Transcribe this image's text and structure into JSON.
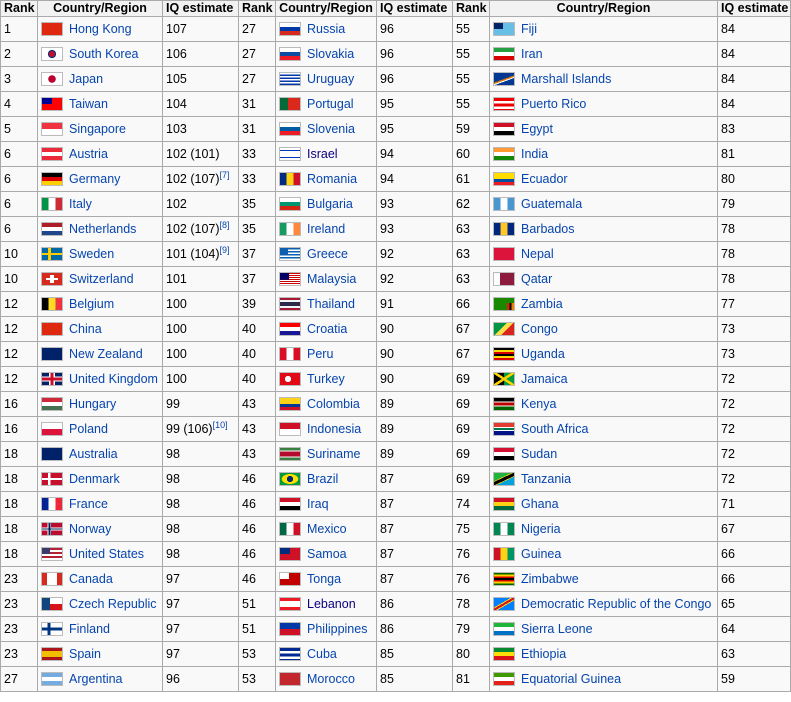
{
  "headers": [
    "Rank",
    "Country/Region",
    "IQ estimate",
    "Rank",
    "Country/Region",
    "IQ estimate",
    "Rank",
    "Country/Region",
    "IQ estimate"
  ],
  "rows": [
    [
      {
        "rank": "1",
        "country": "Hong Kong",
        "iq": "107",
        "flag": "hong-kong"
      },
      {
        "rank": "27",
        "country": "Russia",
        "iq": "96",
        "flag": "russia"
      },
      {
        "rank": "55",
        "country": "Fiji",
        "iq": "84",
        "flag": "fiji"
      }
    ],
    [
      {
        "rank": "2",
        "country": "South Korea",
        "iq": "106",
        "flag": "south-korea"
      },
      {
        "rank": "27",
        "country": "Slovakia",
        "iq": "96",
        "flag": "slovakia"
      },
      {
        "rank": "55",
        "country": "Iran",
        "iq": "84",
        "flag": "iran"
      }
    ],
    [
      {
        "rank": "3",
        "country": "Japan",
        "iq": "105",
        "flag": "japan"
      },
      {
        "rank": "27",
        "country": "Uruguay",
        "iq": "96",
        "flag": "uruguay"
      },
      {
        "rank": "55",
        "country": "Marshall Islands",
        "iq": "84",
        "flag": "marshall-islands"
      }
    ],
    [
      {
        "rank": "4",
        "country": "Taiwan",
        "iq": "104",
        "flag": "taiwan"
      },
      {
        "rank": "31",
        "country": "Portugal",
        "iq": "95",
        "flag": "portugal"
      },
      {
        "rank": "55",
        "country": "Puerto Rico",
        "iq": "84",
        "flag": "puerto-rico"
      }
    ],
    [
      {
        "rank": "5",
        "country": "Singapore",
        "iq": "103",
        "flag": "singapore"
      },
      {
        "rank": "31",
        "country": "Slovenia",
        "iq": "95",
        "flag": "slovenia"
      },
      {
        "rank": "59",
        "country": "Egypt",
        "iq": "83",
        "flag": "egypt"
      }
    ],
    [
      {
        "rank": "6",
        "country": "Austria",
        "iq": "102 (101)",
        "flag": "austria"
      },
      {
        "rank": "33",
        "country": "Israel",
        "iq": "94",
        "flag": "israel",
        "visited": true
      },
      {
        "rank": "60",
        "country": "India",
        "iq": "81",
        "flag": "india"
      }
    ],
    [
      {
        "rank": "6",
        "country": "Germany",
        "iq": "102 (107)",
        "ref": "[7]",
        "flag": "germany"
      },
      {
        "rank": "33",
        "country": "Romania",
        "iq": "94",
        "flag": "romania"
      },
      {
        "rank": "61",
        "country": "Ecuador",
        "iq": "80",
        "flag": "ecuador"
      }
    ],
    [
      {
        "rank": "6",
        "country": "Italy",
        "iq": "102",
        "flag": "italy"
      },
      {
        "rank": "35",
        "country": "Bulgaria",
        "iq": "93",
        "flag": "bulgaria"
      },
      {
        "rank": "62",
        "country": "Guatemala",
        "iq": "79",
        "flag": "guatemala"
      }
    ],
    [
      {
        "rank": "6",
        "country": "Netherlands",
        "iq": "102 (107)",
        "ref": "[8]",
        "flag": "netherlands"
      },
      {
        "rank": "35",
        "country": "Ireland",
        "iq": "93",
        "flag": "ireland"
      },
      {
        "rank": "63",
        "country": "Barbados",
        "iq": "78",
        "flag": "barbados"
      }
    ],
    [
      {
        "rank": "10",
        "country": "Sweden",
        "iq": "101 (104)",
        "ref": "[9]",
        "flag": "sweden"
      },
      {
        "rank": "37",
        "country": "Greece",
        "iq": "92",
        "flag": "greece"
      },
      {
        "rank": "63",
        "country": "Nepal",
        "iq": "78",
        "flag": "nepal"
      }
    ],
    [
      {
        "rank": "10",
        "country": "Switzerland",
        "iq": "101",
        "flag": "switzerland"
      },
      {
        "rank": "37",
        "country": "Malaysia",
        "iq": "92",
        "flag": "malaysia"
      },
      {
        "rank": "63",
        "country": "Qatar",
        "iq": "78",
        "flag": "qatar"
      }
    ],
    [
      {
        "rank": "12",
        "country": "Belgium",
        "iq": "100",
        "flag": "belgium"
      },
      {
        "rank": "39",
        "country": "Thailand",
        "iq": "91",
        "flag": "thailand"
      },
      {
        "rank": "66",
        "country": "Zambia",
        "iq": "77",
        "flag": "zambia"
      }
    ],
    [
      {
        "rank": "12",
        "country": "China",
        "iq": "100",
        "flag": "china"
      },
      {
        "rank": "40",
        "country": "Croatia",
        "iq": "90",
        "flag": "croatia"
      },
      {
        "rank": "67",
        "country": "Congo",
        "iq": "73",
        "flag": "congo"
      }
    ],
    [
      {
        "rank": "12",
        "country": "New Zealand",
        "iq": "100",
        "flag": "new-zealand"
      },
      {
        "rank": "40",
        "country": "Peru",
        "iq": "90",
        "flag": "peru"
      },
      {
        "rank": "67",
        "country": "Uganda",
        "iq": "73",
        "flag": "uganda"
      }
    ],
    [
      {
        "rank": "12",
        "country": "United Kingdom",
        "iq": "100",
        "flag": "united-kingdom"
      },
      {
        "rank": "40",
        "country": "Turkey",
        "iq": "90",
        "flag": "turkey"
      },
      {
        "rank": "69",
        "country": "Jamaica",
        "iq": "72",
        "flag": "jamaica"
      }
    ],
    [
      {
        "rank": "16",
        "country": "Hungary",
        "iq": "99",
        "flag": "hungary"
      },
      {
        "rank": "43",
        "country": "Colombia",
        "iq": "89",
        "flag": "colombia"
      },
      {
        "rank": "69",
        "country": "Kenya",
        "iq": "72",
        "flag": "kenya"
      }
    ],
    [
      {
        "rank": "16",
        "country": "Poland",
        "iq": "99 (106)",
        "ref": "[10]",
        "flag": "poland"
      },
      {
        "rank": "43",
        "country": "Indonesia",
        "iq": "89",
        "flag": "indonesia"
      },
      {
        "rank": "69",
        "country": "South Africa",
        "iq": "72",
        "flag": "south-africa"
      }
    ],
    [
      {
        "rank": "18",
        "country": "Australia",
        "iq": "98",
        "flag": "australia"
      },
      {
        "rank": "43",
        "country": "Suriname",
        "iq": "89",
        "flag": "suriname"
      },
      {
        "rank": "69",
        "country": "Sudan",
        "iq": "72",
        "flag": "sudan"
      }
    ],
    [
      {
        "rank": "18",
        "country": "Denmark",
        "iq": "98",
        "flag": "denmark"
      },
      {
        "rank": "46",
        "country": "Brazil",
        "iq": "87",
        "flag": "brazil"
      },
      {
        "rank": "69",
        "country": "Tanzania",
        "iq": "72",
        "flag": "tanzania"
      }
    ],
    [
      {
        "rank": "18",
        "country": "France",
        "iq": "98",
        "flag": "france"
      },
      {
        "rank": "46",
        "country": "Iraq",
        "iq": "87",
        "flag": "iraq"
      },
      {
        "rank": "74",
        "country": "Ghana",
        "iq": "71",
        "flag": "ghana"
      }
    ],
    [
      {
        "rank": "18",
        "country": "Norway",
        "iq": "98",
        "flag": "norway"
      },
      {
        "rank": "46",
        "country": "Mexico",
        "iq": "87",
        "flag": "mexico"
      },
      {
        "rank": "75",
        "country": "Nigeria",
        "iq": "67",
        "flag": "nigeria"
      }
    ],
    [
      {
        "rank": "18",
        "country": "United States",
        "iq": "98",
        "flag": "united-states"
      },
      {
        "rank": "46",
        "country": "Samoa",
        "iq": "87",
        "flag": "samoa"
      },
      {
        "rank": "76",
        "country": "Guinea",
        "iq": "66",
        "flag": "guinea"
      }
    ],
    [
      {
        "rank": "23",
        "country": "Canada",
        "iq": "97",
        "flag": "canada"
      },
      {
        "rank": "46",
        "country": "Tonga",
        "iq": "87",
        "flag": "tonga"
      },
      {
        "rank": "76",
        "country": "Zimbabwe",
        "iq": "66",
        "flag": "zimbabwe"
      }
    ],
    [
      {
        "rank": "23",
        "country": "Czech Republic",
        "iq": "97",
        "flag": "czech-republic"
      },
      {
        "rank": "51",
        "country": "Lebanon",
        "iq": "86",
        "flag": "lebanon",
        "visited": true
      },
      {
        "rank": "78",
        "country": "Democratic Republic of the Congo",
        "iq": "65",
        "flag": "dr-congo"
      }
    ],
    [
      {
        "rank": "23",
        "country": "Finland",
        "iq": "97",
        "flag": "finland"
      },
      {
        "rank": "51",
        "country": "Philippines",
        "iq": "86",
        "flag": "philippines"
      },
      {
        "rank": "79",
        "country": "Sierra Leone",
        "iq": "64",
        "flag": "sierra-leone"
      }
    ],
    [
      {
        "rank": "23",
        "country": "Spain",
        "iq": "97",
        "flag": "spain"
      },
      {
        "rank": "53",
        "country": "Cuba",
        "iq": "85",
        "flag": "cuba"
      },
      {
        "rank": "80",
        "country": "Ethiopia",
        "iq": "63",
        "flag": "ethiopia"
      }
    ],
    [
      {
        "rank": "27",
        "country": "Argentina",
        "iq": "96",
        "flag": "argentina"
      },
      {
        "rank": "53",
        "country": "Morocco",
        "iq": "85",
        "flag": "morocco"
      },
      {
        "rank": "81",
        "country": "Equatorial Guinea",
        "iq": "59",
        "flag": "equatorial-guinea"
      }
    ]
  ],
  "flag_styles": {
    "hong-kong": "#de2910",
    "south-korea": "radial-gradient(circle at 50% 50%, #c60c30 0 3px, #003478 3px 4px, #ffffff 4px)",
    "japan": "radial-gradient(circle at 50% 50%, #bc002d 0 3.5px, #ffffff 4px)",
    "taiwan": "linear-gradient(to right, #000095 0 50%, transparent 50%) top left/100% 50% no-repeat, #fe0000",
    "singapore": "linear-gradient(#ef3340 0 50%, #ffffff 50%)",
    "austria": "linear-gradient(#ed2939 0 33.3%, #ffffff 33.3% 66.6%, #ed2939 66.6%)",
    "germany": "linear-gradient(#000000 0 33.3%, #dd0000 33.3% 66.6%, #ffce00 66.6%)",
    "italy": "linear-gradient(to right, #009246 0 33.3%, #ffffff 33.3% 66.6%, #ce2b37 66.6%)",
    "netherlands": "linear-gradient(#ae1c28 0 33.3%, #ffffff 33.3% 66.6%, #21468b 66.6%)",
    "sweden": "linear-gradient(to right, transparent 0 30%, #fecc00 30% 44%, transparent 44%), linear-gradient(transparent 0 40%, #fecc00 40% 60%, transparent 60%), #006aa7",
    "switzerland": "linear-gradient(transparent 0 40%, #ffffff 40% 60%, transparent 60%) center/60% 100% no-repeat, linear-gradient(to right, transparent 0 40%, #ffffff 40% 60%, transparent 60%) center/100% 70% no-repeat, #d52b1e",
    "belgium": "linear-gradient(to right, #000000 0 33.3%, #fdda24 33.3% 66.6%, #ef3340 66.6%)",
    "china": "#de2910",
    "new-zealand": "#012169",
    "united-kingdom": "linear-gradient(transparent 0 38%, #c8102e 38% 62%, transparent 62%), linear-gradient(to right, transparent 0 42%, #c8102e 42% 58%, transparent 58%), linear-gradient(transparent 0 30%, #ffffff 30% 70%, transparent 70%), linear-gradient(to right, transparent 0 36%, #ffffff 36% 64%, transparent 64%), #012169",
    "hungary": "linear-gradient(#ce2939 0 33.3%, #ffffff 33.3% 66.6%, #477050 66.6%)",
    "poland": "linear-gradient(#ffffff 0 50%, #dc143c 50%)",
    "australia": "#012169",
    "denmark": "linear-gradient(to right, transparent 0 30%, #ffffff 30% 42%, transparent 42%), linear-gradient(transparent 0 42%, #ffffff 42% 58%, transparent 58%), #c8102e",
    "france": "linear-gradient(to right, #002395 0 33.3%, #ffffff 33.3% 66.6%, #ed2939 66.6%)",
    "norway": "linear-gradient(to right, transparent 0 32%, #00205b 32% 42%, transparent 42%), linear-gradient(transparent 0 44%, #00205b 44% 56%, transparent 56%), linear-gradient(to right, transparent 0 28%, #ffffff 28% 46%, transparent 46%), linear-gradient(transparent 0 36%, #ffffff 36% 64%, transparent 64%), #ba0c2f",
    "united-states": "linear-gradient(to right, #3c3b6e 0 40%, transparent 40%) top left/100% 54% no-repeat, repeating-linear-gradient(#b22234 0 2px, #ffffff 2px 4px)",
    "canada": "linear-gradient(to right, #d52b1e 0 25%, #ffffff 25% 75%, #d52b1e 75%)",
    "czech-republic": "linear-gradient(to right, #11457e 0 40%, transparent 40%), linear-gradient(#ffffff 0 50%, #d7141a 50%)",
    "finland": "linear-gradient(to right, transparent 0 28%, #003580 28% 42%, transparent 42%), linear-gradient(transparent 0 38%, #003580 38% 62%, transparent 62%), #ffffff",
    "spain": "linear-gradient(#aa151b 0 25%, #f1bf00 25% 75%, #aa151b 75%)",
    "argentina": "linear-gradient(#74acdf 0 33.3%, #ffffff 33.3% 66.6%, #74acdf 66.6%)",
    "russia": "linear-gradient(#ffffff 0 33.3%, #0039a6 33.3% 66.6%, #d52b1e 66.6%)",
    "slovakia": "linear-gradient(#ffffff 0 33.3%, #0b4ea2 33.3% 66.6%, #ee1c25 66.6%)",
    "uruguay": "repeating-linear-gradient(#ffffff 0 1.5px, #0038a8 1.5px 3px)",
    "portugal": "linear-gradient(to right, #046a38 0 40%, #da291c 40%)",
    "slovenia": "linear-gradient(#ffffff 0 33.3%, #005da4 33.3% 66.6%, #ed1c24 66.6%)",
    "israel": "linear-gradient(#ffffff 0 15%, #0038b8 15% 25%, #ffffff 25% 75%, #0038b8 75% 85%, #ffffff 85%)",
    "romania": "linear-gradient(to right, #002b7f 0 33.3%, #fcd116 33.3% 66.6%, #ce1126 66.6%)",
    "bulgaria": "linear-gradient(#ffffff 0 33.3%, #00966e 33.3% 66.6%, #d62612 66.6%)",
    "ireland": "linear-gradient(to right, #169b62 0 33.3%, #ffffff 33.3% 66.6%, #ff883e 66.6%)",
    "greece": "linear-gradient(to right, #0d5eaf 0 40%, transparent 40%) top left/100% 55% no-repeat, repeating-linear-gradient(#0d5eaf 0 1.5px, #ffffff 1.5px 3px)",
    "malaysia": "linear-gradient(to right, #010066 0 45%, transparent 45%) top left/100% 57% no-repeat, repeating-linear-gradient(#cc0001 0 1px, #ffffff 1px 2px)",
    "thailand": "linear-gradient(#a51931 0 16%, #f4f5f8 16% 33%, #2d2a4a 33% 67%, #f4f5f8 67% 84%, #a51931 84%)",
    "croatia": "linear-gradient(#ff0000 0 33.3%, #ffffff 33.3% 66.6%, #171796 66.6%)",
    "peru": "linear-gradient(to right, #d91023 0 33.3%, #ffffff 33.3% 66.6%, #d91023 66.6%)",
    "turkey": "radial-gradient(circle at 40% 50%, #ffffff 0 3px, transparent 3.2px), #e30a17",
    "colombia": "linear-gradient(#fcd116 0 50%, #003893 50% 75%, #ce1126 75%)",
    "indonesia": "linear-gradient(#ce1126 0 50%, #ffffff 50%)",
    "suriname": "linear-gradient(#377e3f 0 20%, #ffffff 20% 30%, #b40a2d 30% 70%, #ffffff 70% 80%, #377e3f 80%)",
    "brazil": "radial-gradient(circle at 50% 50%, #002776 0 3px, transparent 3.2px), radial-gradient(ellipse at 50% 50%, #ffdf00 0 8px, transparent 8.5px), #009c3b",
    "iraq": "linear-gradient(#ce1126 0 33.3%, #ffffff 33.3% 66.6%, #000000 66.6%)",
    "mexico": "linear-gradient(to right, #006847 0 33.3%, #ffffff 33.3% 66.6%, #ce1126 66.6%)",
    "samoa": "linear-gradient(to right, #002b7f 0 50%, transparent 50%) top left/100% 50% no-repeat, #ce1126",
    "tonga": "linear-gradient(to right, #ffffff 0 45%, transparent 45%) top left/100% 50% no-repeat, #c10000",
    "lebanon": "linear-gradient(#ed1c24 0 25%, #ffffff 25% 75%, #ed1c24 75%)",
    "philippines": "linear-gradient(#0038a8 0 50%, #ce1126 50%)",
    "cuba": "repeating-linear-gradient(#002a8f 0 2.8px, #ffffff 2.8px 5.6px)",
    "morocco": "#c1272d",
    "fiji": "linear-gradient(to right, #012169 0 45%, transparent 45%) top left/100% 50% no-repeat, #68bfe5",
    "iran": "linear-gradient(#239f40 0 33.3%, #ffffff 33.3% 66.6%, #da0000 66.6%)",
    "marshall-islands": "linear-gradient(160deg, transparent 0 50%, #dd7500 50% 58%, #ffffff 58% 64%, transparent 64%), #003893",
    "puerto-rico": "repeating-linear-gradient(#ed0000 0 2.8px, #ffffff 2.8px 5.6px)",
    "egypt": "linear-gradient(#ce1126 0 33.3%, #ffffff 33.3% 66.6%, #000000 66.6%)",
    "india": "linear-gradient(#ff9933 0 33.3%, #ffffff 33.3% 66.6%, #138808 66.6%)",
    "ecuador": "linear-gradient(#ffdd00 0 50%, #034ea2 50% 75%, #ed1c24 75%)",
    "guatemala": "linear-gradient(to right, #4997d0 0 33.3%, #ffffff 33.3% 66.6%, #4997d0 66.6%)",
    "barbados": "linear-gradient(to right, #00267f 0 33.3%, #ffc726 33.3% 66.6%, #00267f 66.6%)",
    "nepal": "#dc143c",
    "qatar": "linear-gradient(to right, #ffffff 0 30%, #8d1b3d 30%)",
    "zambia": "linear-gradient(to right, transparent 0 65%, #de2010 65% 77%, #000000 77% 88%, #ef7d00 88%) bottom/100% 60% no-repeat, #198a00",
    "congo": "linear-gradient(135deg, #009543 0 40%, #fbde4a 40% 60%, #dc241f 60%)",
    "uganda": "linear-gradient(#000000 0 16.6%, #fcdc04 16.6% 33.3%, #d90000 33.3% 50%, #000000 50% 66.6%, #fcdc04 66.6% 83.3%, #d90000 83.3%)",
    "jamaica": "linear-gradient(33deg, transparent 0 44%, #fed100 44% 56%, transparent 56%), linear-gradient(-33deg, transparent 0 44%, #fed100 44% 56%, transparent 56%), linear-gradient(to right, #000000 0 50%, #009b3a 50%)",
    "kenya": "linear-gradient(#000000 0 30%, #ffffff 30% 36%, #bb0000 36% 64%, #ffffff 64% 70%, #006600 70%)",
    "south-africa": "linear-gradient(#e03c31 0 33.3%, #ffffff 33.3% 40%, #007749 40% 60%, #ffffff 60% 66.6%, #001489 66.6%)",
    "sudan": "linear-gradient(#d21034 0 33.3%, #ffffff 33.3% 66.6%, #000000 66.6%)",
    "tanzania": "linear-gradient(155deg, #1eb53a 0 38%, #fcd116 38% 42%, #000000 42% 58%, #fcd116 58% 62%, #00a3dd 62%)",
    "ghana": "linear-gradient(#ce1126 0 33.3%, #fcd116 33.3% 66.6%, #006b3f 66.6%)",
    "nigeria": "linear-gradient(to right, #008751 0 33.3%, #ffffff 33.3% 66.6%, #008751 66.6%)",
    "guinea": "linear-gradient(to right, #ce1126 0 33.3%, #fcd116 33.3% 66.6%, #009460 66.6%)",
    "zimbabwe": "linear-gradient(#006400 0 14%, #ffd200 14% 28%, #d40000 28% 42%, #000000 42% 58%, #d40000 58% 72%, #ffd200 72% 86%, #006400 86%)",
    "dr-congo": "linear-gradient(150deg, #007fff 0 40%, #f7d618 40% 45%, #ce1021 45% 55%, #f7d618 55% 60%, #007fff 60%)",
    "sierra-leone": "linear-gradient(#1eb53a 0 33.3%, #ffffff 33.3% 66.6%, #0072c6 66.6%)",
    "ethiopia": "linear-gradient(#078930 0 33.3%, #fcdd09 33.3% 66.6%, #da121a 66.6%)",
    "equatorial-guinea": "linear-gradient(#3e9a00 0 33.3%, #ffffff 33.3% 66.6%, #e32118 66.6%)"
  }
}
